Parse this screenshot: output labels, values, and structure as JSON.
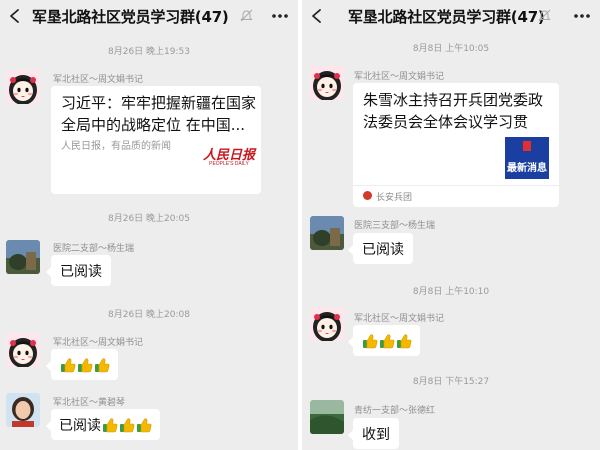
{
  "left": {
    "title": "军垦北路社区党员学习群(47)",
    "messages": [
      {
        "time": "8月26日 晚上19:53"
      },
      {
        "sender": "军北社区～周文娟书记",
        "card_title": "习近平：牢牢把握新疆在国家全局中的战略定位 在中国...",
        "card_desc": "人民日报，有品质的新闻",
        "card_logo": "人民日报",
        "card_logo_sub": "PEOPLE'S DAILY"
      },
      {
        "time": "8月26日 晚上20:05"
      },
      {
        "sender": "医院二支部～杨生瑞",
        "text": "已阅读"
      },
      {
        "time": "8月26日 晚上20:08"
      },
      {
        "sender": "军北社区～周文娟书记",
        "text": ""
      },
      {
        "sender": "军北社区～黄碧琴",
        "text": "已阅读"
      }
    ]
  },
  "right": {
    "title": "军垦北路社区党员学习群(47)",
    "messages": [
      {
        "time": "8月8日 上午10:05"
      },
      {
        "sender": "军北社区～周文娟书记",
        "card_title": "朱雪冰主持召开兵团党委政法委员会全体会议学习贯彻...",
        "card_badge": "最新消息",
        "card_source": "长安兵团"
      },
      {
        "sender": "医院三支部～杨生瑞",
        "text": "已阅读"
      },
      {
        "time": "8月8日 上午10:10"
      },
      {
        "sender": "军北社区～周文娟书记",
        "text": ""
      },
      {
        "time": "8月8日 下午15:27"
      },
      {
        "sender": "青纺一支部～张德红",
        "text": "收到"
      }
    ]
  },
  "colors": {
    "bg": "#ededed",
    "bubble": "#ffffff",
    "thumb": "#f5b800",
    "cuff": "#3e9b3e",
    "red": "#c8161d"
  }
}
